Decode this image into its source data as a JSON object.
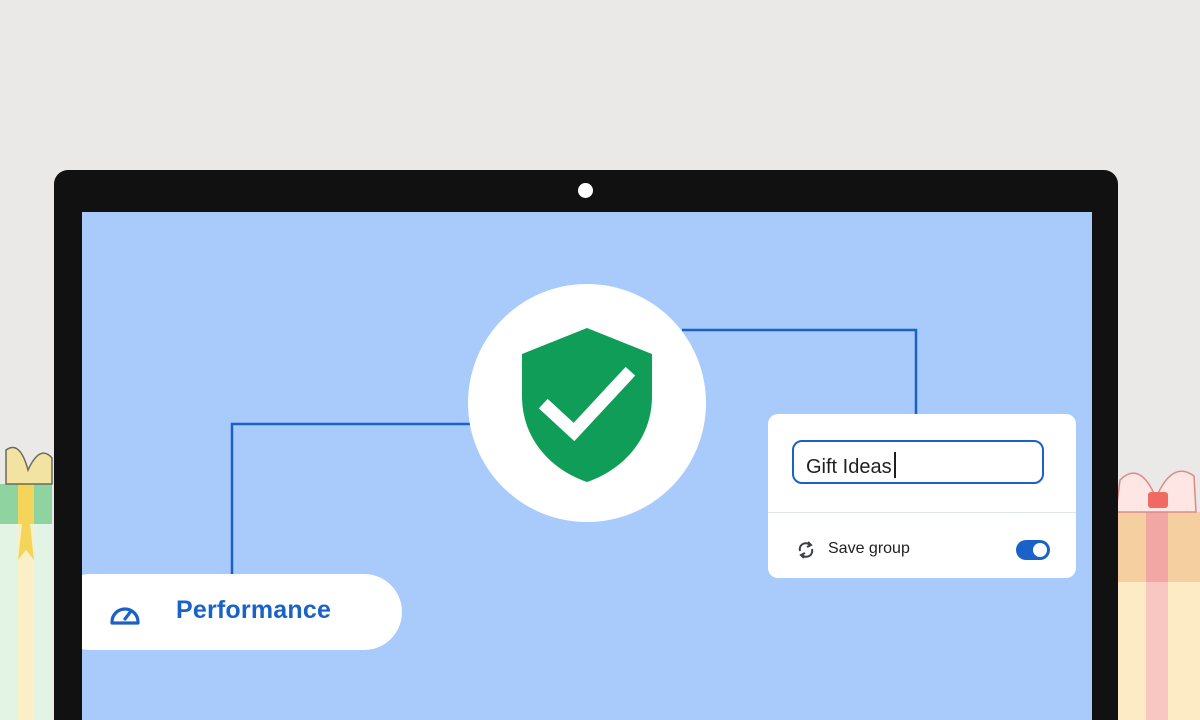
{
  "performance": {
    "label": "Performance",
    "icon": "gauge-icon"
  },
  "security": {
    "icon": "shield-check-icon",
    "shield_color": "#0f9d58"
  },
  "tab_group": {
    "name_value": "Gift Ideas",
    "save_label": "Save group",
    "save_enabled": true,
    "sync_icon": "sync-icon"
  },
  "colors": {
    "screen": "#a8cbfb",
    "accent": "#1a62c8",
    "frame": "#111111",
    "background": "#ebe8e8"
  }
}
